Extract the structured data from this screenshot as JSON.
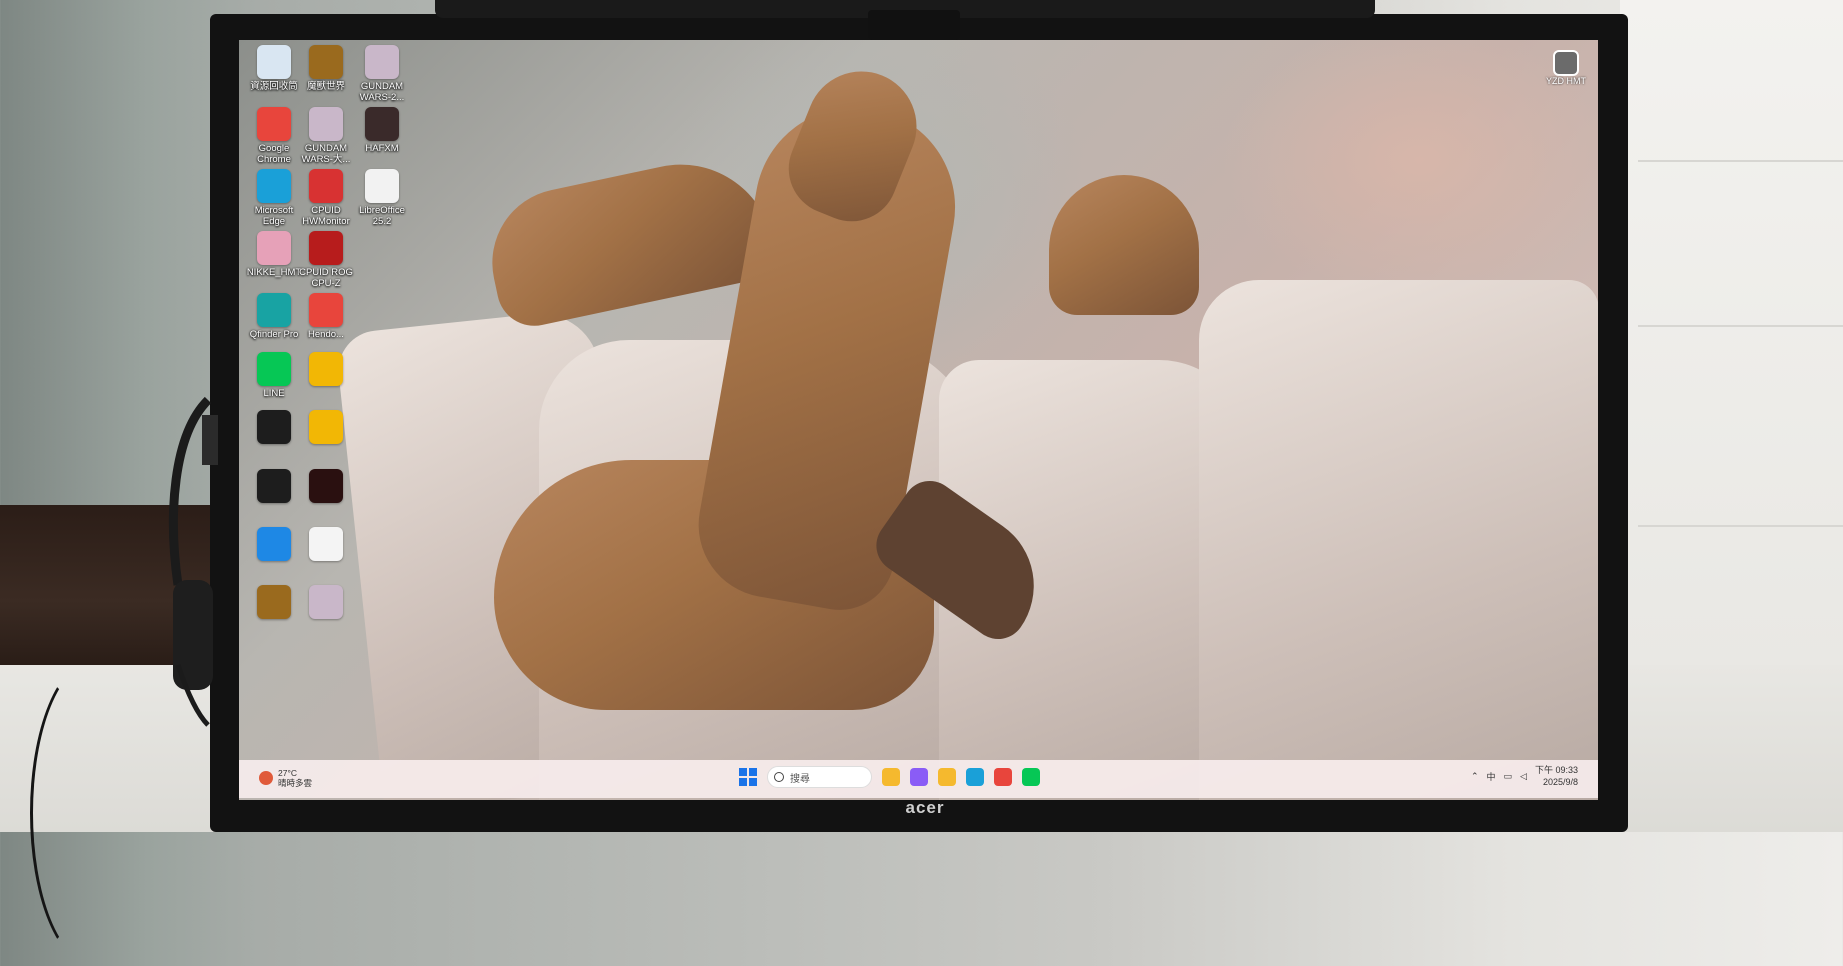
{
  "desktop": {
    "icons": [
      {
        "label": "資源回收筒",
        "icon": "recycle-bin-icon",
        "color": "#d9e6f2"
      },
      {
        "label": "魔獸世界",
        "icon": "wow-icon",
        "color": "#9a6a1e"
      },
      {
        "label": "GUNDAM WARS-2...",
        "icon": "gundam-icon",
        "color": "#c9b7c9"
      },
      {
        "label": "Google Chrome",
        "icon": "chrome-icon",
        "color": "#e8453c"
      },
      {
        "label": "GUNDAM WARS-大...",
        "icon": "gundam-icon",
        "color": "#c9b7c9"
      },
      {
        "label": "HAFXM",
        "icon": "haf-icon",
        "color": "#3a2a2a"
      },
      {
        "label": "Microsoft Edge",
        "icon": "edge-icon",
        "color": "#1aa0d8"
      },
      {
        "label": "CPUID HWMonitor",
        "icon": "hwmonitor-icon",
        "color": "#d83232"
      },
      {
        "label": "LibreOffice 25.2",
        "icon": "libreoffice-icon",
        "color": "#f2f2f2"
      },
      {
        "label": "NIKKE_HMT",
        "icon": "nikke-icon",
        "color": "#e6a1b8"
      },
      {
        "label": "CPUID ROG CPU-Z",
        "icon": "rog-cpuz-icon",
        "color": "#b71c1c"
      },
      {
        "label": "Qfinder Pro",
        "icon": "qfinder-icon",
        "color": "#18a3a3"
      },
      {
        "label": "Hendo...",
        "icon": "chrome-app-icon",
        "color": "#e8453c"
      },
      {
        "label": "LINE",
        "icon": "line-icon",
        "color": "#06c755"
      },
      {
        "label": "",
        "icon": "ring-app-icon",
        "color": "#f2b705"
      },
      {
        "label": "",
        "icon": "nox-icon",
        "color": "#1d1d1d"
      },
      {
        "label": "",
        "icon": "power-app-icon",
        "color": "#f2b705"
      },
      {
        "label": "",
        "icon": "nox-icon",
        "color": "#1d1d1d"
      },
      {
        "label": "",
        "icon": "game-launcher-icon",
        "color": "#2a1010"
      },
      {
        "label": "",
        "icon": "network-app-icon",
        "color": "#1e88e5"
      },
      {
        "label": "",
        "icon": "file-icon",
        "color": "#f4f4f4"
      },
      {
        "label": "",
        "icon": "wow-icon",
        "color": "#9a6a1e"
      },
      {
        "label": "",
        "icon": "gundam-icon",
        "color": "#c9b7c9"
      }
    ],
    "corner_widget": {
      "label": "YZD HMT"
    }
  },
  "taskbar": {
    "weather": {
      "temp": "27°C",
      "desc": "晴時多雲"
    },
    "search_placeholder": "搜尋",
    "pinned": [
      {
        "icon": "file-explorer-icon",
        "color": "#f5b92e"
      },
      {
        "icon": "copilot-icon",
        "color": "#8a5cf6"
      },
      {
        "icon": "folder-icon",
        "color": "#f5b92e"
      },
      {
        "icon": "edge-icon",
        "color": "#1aa0d8"
      },
      {
        "icon": "chrome-icon",
        "color": "#e8453c"
      },
      {
        "icon": "line-icon",
        "color": "#06c755"
      }
    ],
    "tray": {
      "ime": "中",
      "time": "下午 09:33",
      "date": "2025/9/8"
    }
  },
  "monitor": {
    "brand": "acer"
  }
}
